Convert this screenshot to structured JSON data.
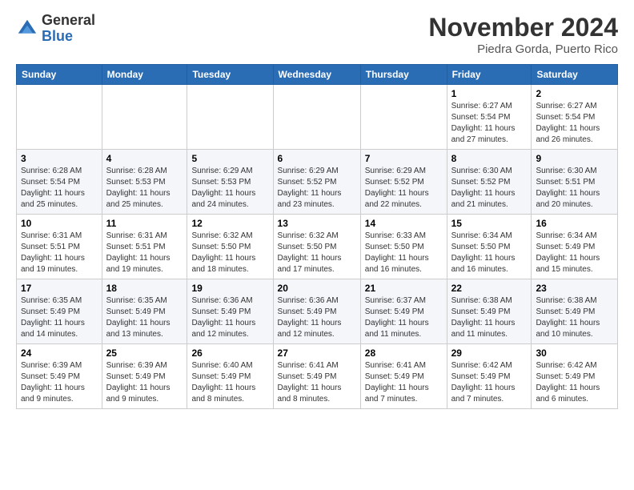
{
  "logo": {
    "general": "General",
    "blue": "Blue"
  },
  "title": "November 2024",
  "subtitle": "Piedra Gorda, Puerto Rico",
  "days_of_week": [
    "Sunday",
    "Monday",
    "Tuesday",
    "Wednesday",
    "Thursday",
    "Friday",
    "Saturday"
  ],
  "weeks": [
    [
      {
        "day": "",
        "info": ""
      },
      {
        "day": "",
        "info": ""
      },
      {
        "day": "",
        "info": ""
      },
      {
        "day": "",
        "info": ""
      },
      {
        "day": "",
        "info": ""
      },
      {
        "day": "1",
        "info": "Sunrise: 6:27 AM\nSunset: 5:54 PM\nDaylight: 11 hours and 27 minutes."
      },
      {
        "day": "2",
        "info": "Sunrise: 6:27 AM\nSunset: 5:54 PM\nDaylight: 11 hours and 26 minutes."
      }
    ],
    [
      {
        "day": "3",
        "info": "Sunrise: 6:28 AM\nSunset: 5:54 PM\nDaylight: 11 hours and 25 minutes."
      },
      {
        "day": "4",
        "info": "Sunrise: 6:28 AM\nSunset: 5:53 PM\nDaylight: 11 hours and 25 minutes."
      },
      {
        "day": "5",
        "info": "Sunrise: 6:29 AM\nSunset: 5:53 PM\nDaylight: 11 hours and 24 minutes."
      },
      {
        "day": "6",
        "info": "Sunrise: 6:29 AM\nSunset: 5:52 PM\nDaylight: 11 hours and 23 minutes."
      },
      {
        "day": "7",
        "info": "Sunrise: 6:29 AM\nSunset: 5:52 PM\nDaylight: 11 hours and 22 minutes."
      },
      {
        "day": "8",
        "info": "Sunrise: 6:30 AM\nSunset: 5:52 PM\nDaylight: 11 hours and 21 minutes."
      },
      {
        "day": "9",
        "info": "Sunrise: 6:30 AM\nSunset: 5:51 PM\nDaylight: 11 hours and 20 minutes."
      }
    ],
    [
      {
        "day": "10",
        "info": "Sunrise: 6:31 AM\nSunset: 5:51 PM\nDaylight: 11 hours and 19 minutes."
      },
      {
        "day": "11",
        "info": "Sunrise: 6:31 AM\nSunset: 5:51 PM\nDaylight: 11 hours and 19 minutes."
      },
      {
        "day": "12",
        "info": "Sunrise: 6:32 AM\nSunset: 5:50 PM\nDaylight: 11 hours and 18 minutes."
      },
      {
        "day": "13",
        "info": "Sunrise: 6:32 AM\nSunset: 5:50 PM\nDaylight: 11 hours and 17 minutes."
      },
      {
        "day": "14",
        "info": "Sunrise: 6:33 AM\nSunset: 5:50 PM\nDaylight: 11 hours and 16 minutes."
      },
      {
        "day": "15",
        "info": "Sunrise: 6:34 AM\nSunset: 5:50 PM\nDaylight: 11 hours and 16 minutes."
      },
      {
        "day": "16",
        "info": "Sunrise: 6:34 AM\nSunset: 5:49 PM\nDaylight: 11 hours and 15 minutes."
      }
    ],
    [
      {
        "day": "17",
        "info": "Sunrise: 6:35 AM\nSunset: 5:49 PM\nDaylight: 11 hours and 14 minutes."
      },
      {
        "day": "18",
        "info": "Sunrise: 6:35 AM\nSunset: 5:49 PM\nDaylight: 11 hours and 13 minutes."
      },
      {
        "day": "19",
        "info": "Sunrise: 6:36 AM\nSunset: 5:49 PM\nDaylight: 11 hours and 12 minutes."
      },
      {
        "day": "20",
        "info": "Sunrise: 6:36 AM\nSunset: 5:49 PM\nDaylight: 11 hours and 12 minutes."
      },
      {
        "day": "21",
        "info": "Sunrise: 6:37 AM\nSunset: 5:49 PM\nDaylight: 11 hours and 11 minutes."
      },
      {
        "day": "22",
        "info": "Sunrise: 6:38 AM\nSunset: 5:49 PM\nDaylight: 11 hours and 11 minutes."
      },
      {
        "day": "23",
        "info": "Sunrise: 6:38 AM\nSunset: 5:49 PM\nDaylight: 11 hours and 10 minutes."
      }
    ],
    [
      {
        "day": "24",
        "info": "Sunrise: 6:39 AM\nSunset: 5:49 PM\nDaylight: 11 hours and 9 minutes."
      },
      {
        "day": "25",
        "info": "Sunrise: 6:39 AM\nSunset: 5:49 PM\nDaylight: 11 hours and 9 minutes."
      },
      {
        "day": "26",
        "info": "Sunrise: 6:40 AM\nSunset: 5:49 PM\nDaylight: 11 hours and 8 minutes."
      },
      {
        "day": "27",
        "info": "Sunrise: 6:41 AM\nSunset: 5:49 PM\nDaylight: 11 hours and 8 minutes."
      },
      {
        "day": "28",
        "info": "Sunrise: 6:41 AM\nSunset: 5:49 PM\nDaylight: 11 hours and 7 minutes."
      },
      {
        "day": "29",
        "info": "Sunrise: 6:42 AM\nSunset: 5:49 PM\nDaylight: 11 hours and 7 minutes."
      },
      {
        "day": "30",
        "info": "Sunrise: 6:42 AM\nSunset: 5:49 PM\nDaylight: 11 hours and 6 minutes."
      }
    ]
  ]
}
